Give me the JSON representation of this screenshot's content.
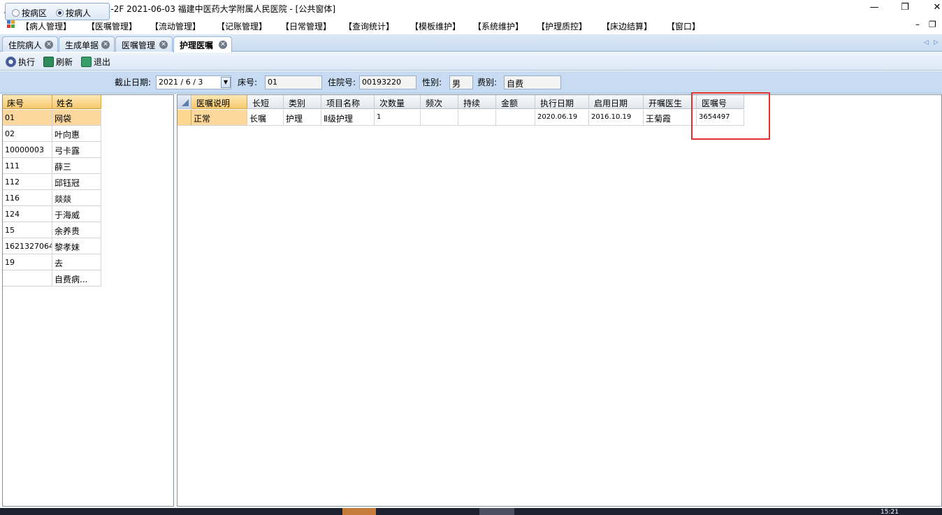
{
  "window": {
    "title": "操作者：管理员  科室：2-2F  2021-06-03  福建中医药大学附属人民医院 - [公共窗体]",
    "minimize": "—",
    "restore": "❐",
    "close": "✕"
  },
  "menu": {
    "items": [
      "【病人管理】",
      "【医嘱管理】",
      "【流动管理】",
      "【记账管理】",
      "【日常管理】",
      "【查询统计】",
      "【模板维护】",
      "【系统维护】",
      "【护理质控】",
      "【床边结算】",
      "【窗口】"
    ],
    "mdi_minimize": "–",
    "mdi_restore": "❐"
  },
  "tabs": [
    {
      "label": "住院病人",
      "active": false
    },
    {
      "label": "生成单据",
      "active": false
    },
    {
      "label": "医嘱管理",
      "active": false
    },
    {
      "label": "护理医嘱",
      "active": true
    }
  ],
  "toolbar": {
    "execute": "执行",
    "refresh": "刷新",
    "exit": "退出"
  },
  "filter": {
    "radio_ward": "按病区",
    "radio_patient": "按病人",
    "selected": "按病人",
    "date_label": "截止日期:",
    "date_value": "2021 / 6 / 3",
    "bed_label": "床号:",
    "bed_value": "01",
    "admission_label": "住院号:",
    "admission_value": "00193220",
    "gender_label": "性别:",
    "gender_value": "男",
    "fee_label": "费别:",
    "fee_value": "自费"
  },
  "patients": {
    "headers": [
      "床号",
      "姓名"
    ],
    "rows": [
      {
        "bed": "01",
        "name": "网袋",
        "selected": true
      },
      {
        "bed": "02",
        "name": "叶向惠",
        "selected": false
      },
      {
        "bed": "10000003",
        "name": "弓卡露",
        "selected": false
      },
      {
        "bed": "111",
        "name": "薛三",
        "selected": false
      },
      {
        "bed": "112",
        "name": "邱钰冠",
        "selected": false
      },
      {
        "bed": "116",
        "name": "燚燚",
        "selected": false
      },
      {
        "bed": "124",
        "name": "于海威",
        "selected": false
      },
      {
        "bed": "15",
        "name": "余养贵",
        "selected": false
      },
      {
        "bed": "1621327064",
        "name": "黎孝妹",
        "selected": false
      },
      {
        "bed": "19",
        "name": "去",
        "selected": false
      },
      {
        "bed": "",
        "name": "自费病...",
        "selected": false
      }
    ]
  },
  "orders": {
    "headers": [
      "医嘱说明",
      "长短",
      "类别",
      "项目名称",
      "次数量",
      "频次",
      "持续",
      "金额",
      "执行日期",
      "启用日期",
      "开嘱医生",
      "医嘱号"
    ],
    "rows": [
      [
        "正常",
        "长嘱",
        "护理",
        "Ⅱ级护理",
        "1",
        "",
        "",
        "",
        "2020.06.19",
        "2016.10.19",
        "王菊霞",
        "3654497"
      ]
    ]
  },
  "taskbar": {
    "clock": "15:21"
  }
}
